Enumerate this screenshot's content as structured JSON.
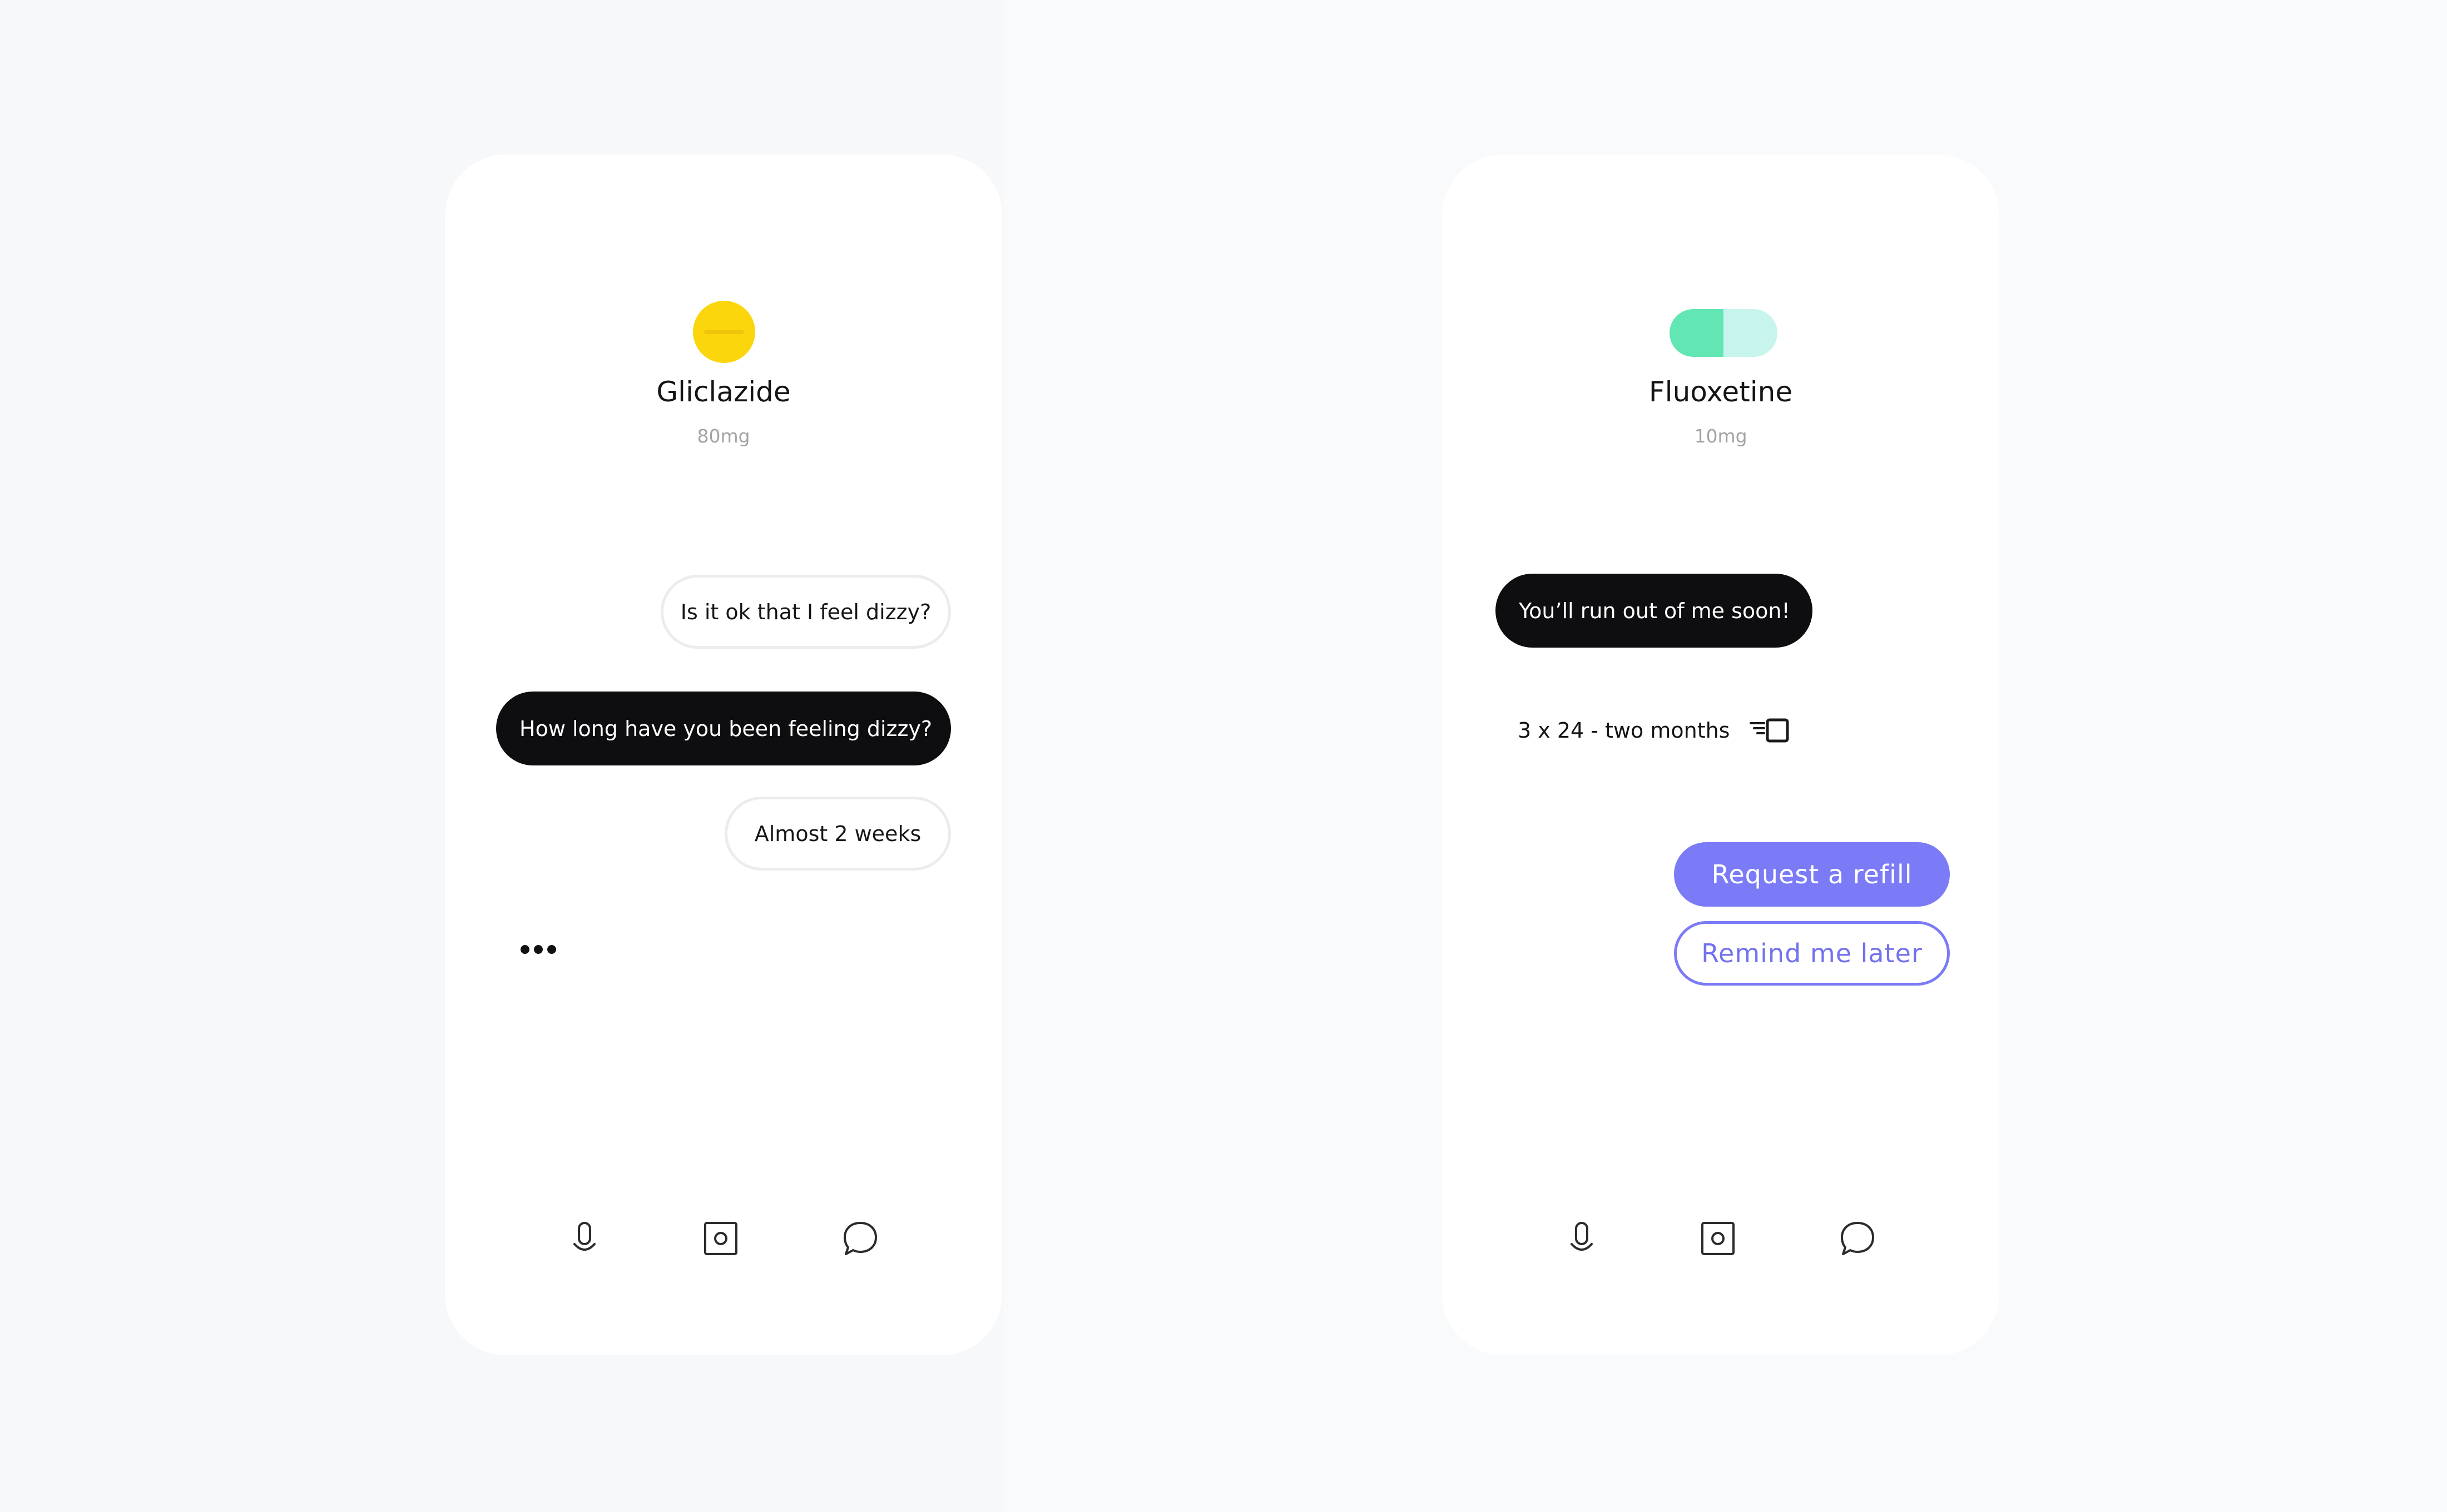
{
  "screens": [
    {
      "medication": {
        "name": "Gliclazide",
        "dose": "80mg",
        "color": "#fcd60c",
        "icon": "round-pill-icon"
      },
      "messages": [
        {
          "role": "user",
          "text": "Is it ok that I feel dizzy?"
        },
        {
          "role": "medication",
          "text": "How long have you been feeling dizzy?"
        },
        {
          "role": "user",
          "text": "Almost 2 weeks"
        }
      ],
      "typing_indicator": true,
      "nav": [
        "microphone-icon",
        "camera-icon",
        "chat-icon"
      ]
    },
    {
      "medication": {
        "name": "Fluoxetine",
        "dose": "10mg",
        "colors": [
          "#62e6b3",
          "#c7f4ec"
        ],
        "icon": "capsule-icon"
      },
      "messages": [
        {
          "role": "medication",
          "text": "You’ll run out of me soon!"
        }
      ],
      "supply": {
        "text": "3 x 24 - two months",
        "icon": "pill-box-icon"
      },
      "actions": {
        "primary": "Request a refill",
        "secondary": "Remind me later",
        "accent": "#7b7bf7"
      },
      "nav": [
        "microphone-icon",
        "camera-icon",
        "chat-icon"
      ]
    }
  ]
}
